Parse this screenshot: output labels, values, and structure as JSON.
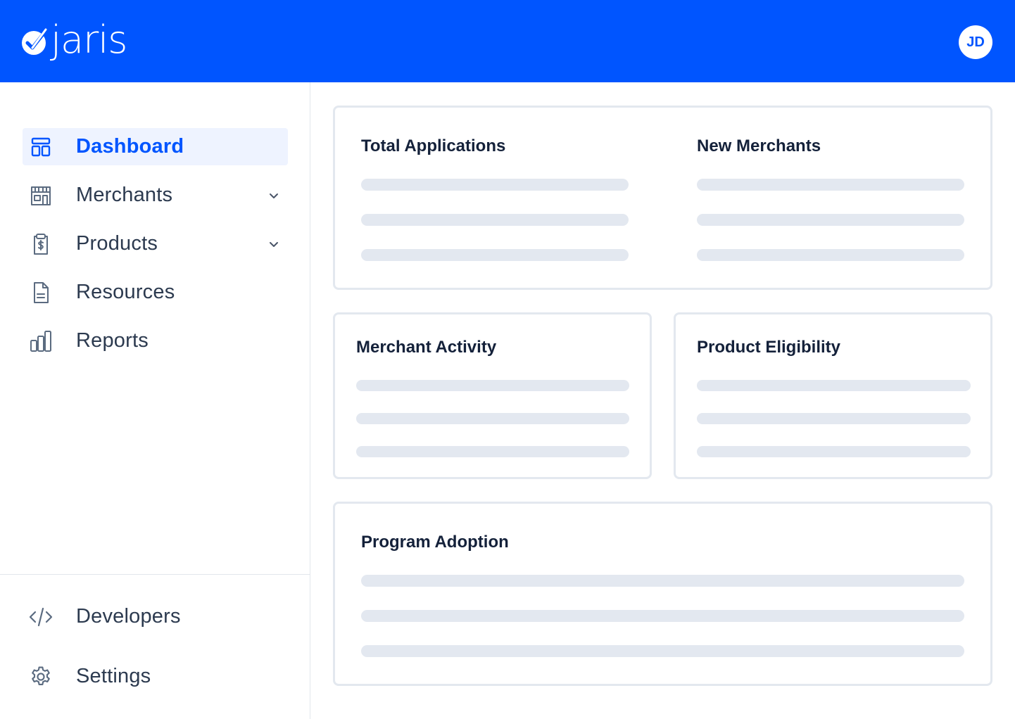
{
  "header": {
    "logo_text": "jaris",
    "avatar_initials": "JD",
    "colors": {
      "brand": "#0055ff",
      "header_bg": "#0055ff"
    }
  },
  "sidebar": {
    "items": [
      {
        "label": "Dashboard",
        "icon": "dashboard-icon",
        "active": true
      },
      {
        "label": "Merchants",
        "icon": "storefront-icon",
        "has_chevron": true
      },
      {
        "label": "Products",
        "icon": "dollar-clipboard-icon",
        "has_chevron": true
      },
      {
        "label": "Resources",
        "icon": "document-icon"
      },
      {
        "label": "Reports",
        "icon": "bar-chart-icon"
      }
    ],
    "bottom_items": [
      {
        "label": "Developers",
        "icon": "code-icon"
      },
      {
        "label": "Settings",
        "icon": "gear-icon"
      }
    ]
  },
  "main": {
    "cards": {
      "total_applications": "Total Applications",
      "new_merchants": "New Merchants",
      "merchant_activity": "Merchant Activity",
      "product_eligibility": "Product Eligibility",
      "program_adoption": "Program Adoption"
    }
  }
}
